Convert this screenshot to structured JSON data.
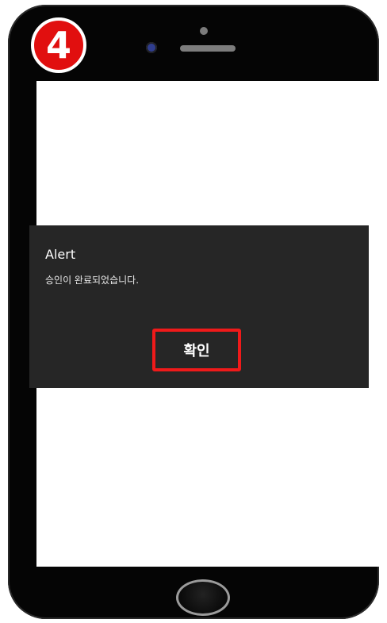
{
  "step_badge": "4",
  "alert": {
    "title": "Alert",
    "message": "승인이 완료되었습니다.",
    "confirm_label": "확인"
  },
  "icons": {
    "camera": "front-camera-icon",
    "speaker": "speaker-grille-icon",
    "home": "home-button-icon"
  },
  "colors": {
    "highlight": "#ef1a1a",
    "badge": "#e10f0f",
    "dialog_bg": "#262626"
  }
}
